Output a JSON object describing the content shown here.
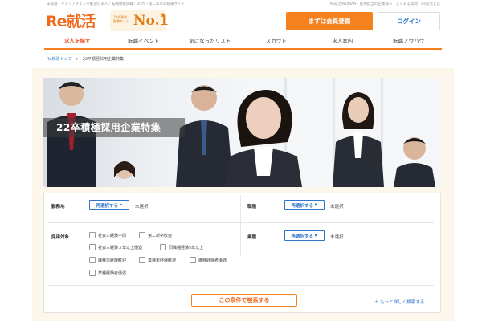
{
  "header": {
    "tagline": "未経験・キャリアチェンジ歓迎の求人｜転職情報満載！20代・第二新卒の転職サイト",
    "top_links": [
      "Re就活WOMAN",
      "採用担当の企業様へ",
      "よくある質問",
      "Re就活とは"
    ],
    "logo_text_latin": "Re",
    "logo_text_jp": "就活",
    "rank_small": "20代専門 転職サイト",
    "rank_main": "No.1",
    "register_label": "まずは会員登録",
    "login_label": "ログイン"
  },
  "nav": {
    "items": [
      {
        "label": "求人を探す",
        "active": true
      },
      {
        "label": "転職イベント",
        "active": false
      },
      {
        "label": "気になったリスト",
        "active": false
      },
      {
        "label": "スカウト",
        "active": false
      },
      {
        "label": "求人案内",
        "active": false
      },
      {
        "label": "転職ノウハウ",
        "active": false
      }
    ]
  },
  "breadcrumb": {
    "home": "Re就活トップ",
    "separator": ">",
    "current": "22卒積極採用企業特集"
  },
  "hero": {
    "title": "22卒積極採用企業特集"
  },
  "search": {
    "location_label": "勤務地",
    "job_type_label": "職種",
    "reselect_label": "再選択する",
    "reselect_arrow": "▶",
    "unselected": "未選択",
    "target_label": "採用対象",
    "industry_label": "業種",
    "targets": [
      "社会人経験不問",
      "第二新卒歓迎",
      "社会人経験３年以上優遇",
      "同職種経験5年以上",
      "職種未経験歓迎",
      "業種未経験歓迎",
      "職種経験者優遇",
      "業種経験者優遇"
    ],
    "search_button": "この条件で検索する",
    "detail_link": "＋ もっと詳しく検索する"
  },
  "colors": {
    "accent_orange": "#f5821f",
    "link_blue": "#2f76c9",
    "frame_bg": "#fcf7ea"
  }
}
